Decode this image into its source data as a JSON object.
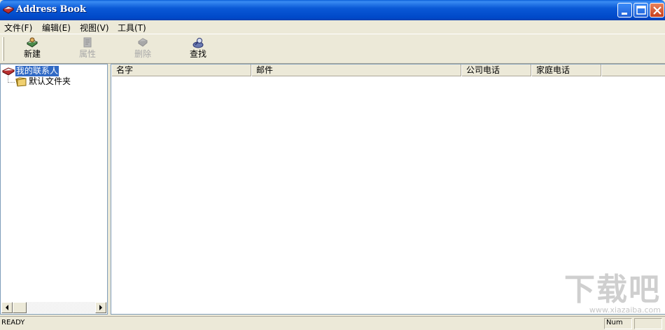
{
  "window": {
    "title": "Address Book",
    "controls": {
      "minimize": "minimize-icon",
      "maximize": "maximize-icon",
      "close": "close-icon"
    }
  },
  "menu": [
    {
      "label": "文件(F)"
    },
    {
      "label": "编辑(E)"
    },
    {
      "label": "视图(V)"
    },
    {
      "label": "工具(T)"
    }
  ],
  "toolbar": [
    {
      "label": "新建",
      "icon": "new-contact-icon",
      "enabled": true
    },
    {
      "label": "属性",
      "icon": "properties-icon",
      "enabled": false
    },
    {
      "label": "删除",
      "icon": "delete-icon",
      "enabled": false
    },
    {
      "label": "查找",
      "icon": "find-icon",
      "enabled": true
    }
  ],
  "tree": {
    "root": {
      "label": "我的联系人",
      "icon": "address-book-icon",
      "selected": true
    },
    "children": [
      {
        "label": "默认文件夹",
        "icon": "folder-icon"
      }
    ]
  },
  "list": {
    "columns": [
      "名字",
      "邮件",
      "公司电话",
      "家庭电话"
    ],
    "rows": []
  },
  "status": {
    "text": "READY",
    "indicator": "Num"
  },
  "watermark": {
    "main": "下载吧",
    "sub": "www.xiazaiba.com"
  },
  "colors": {
    "titlebar": "#0a59d6",
    "selection": "#316ac5",
    "chrome": "#ece9d8"
  }
}
